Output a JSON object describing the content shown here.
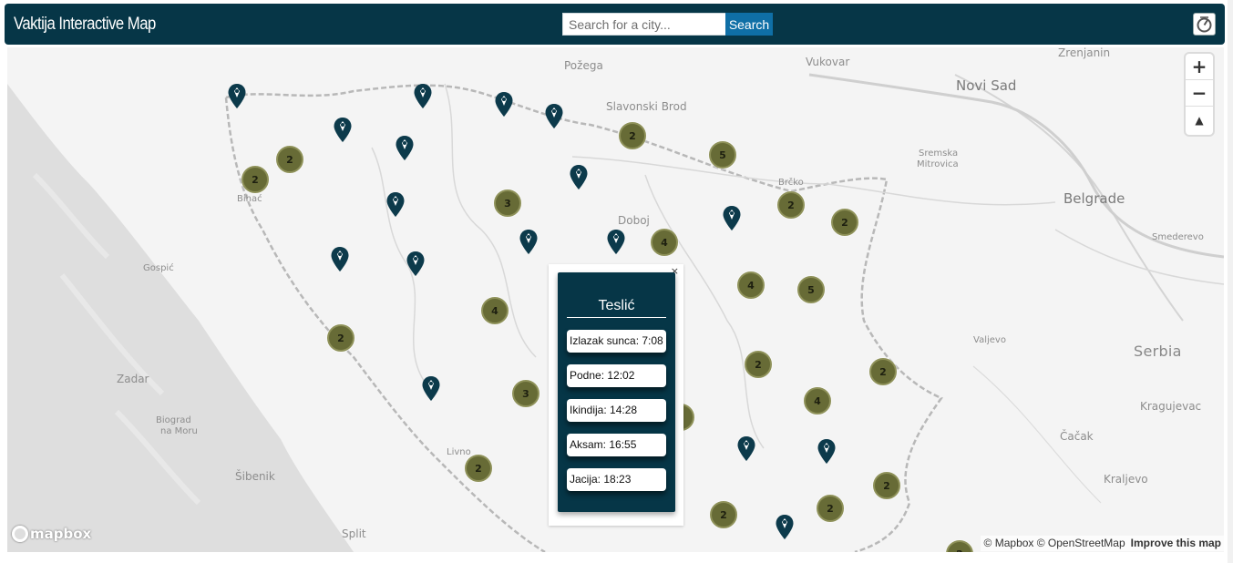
{
  "app": {
    "title": "Vaktija Interactive Map",
    "search_placeholder": "Search for a city...",
    "search_button": "Search",
    "locate_icon": "geolocate-icon"
  },
  "map_controls": {
    "zoom_in": "+",
    "zoom_out": "−",
    "compass": "▲"
  },
  "places": [
    {
      "name": "Požega",
      "kind": "city"
    },
    {
      "name": "Vukovar",
      "kind": "city"
    },
    {
      "name": "Zrenjanin",
      "kind": "city"
    },
    {
      "name": "Novi Sad",
      "kind": "large"
    },
    {
      "name": "Slavonski Brod",
      "kind": "city"
    },
    {
      "name": "Sremska",
      "kind": "small"
    },
    {
      "name": "Mitrovica",
      "kind": "small"
    },
    {
      "name": "Brčko",
      "kind": "small"
    },
    {
      "name": "Belgrade",
      "kind": "large"
    },
    {
      "name": "Doboj",
      "kind": "city"
    },
    {
      "name": "Bihać",
      "kind": "small"
    },
    {
      "name": "Smederevo",
      "kind": "small"
    },
    {
      "name": "Gospić",
      "kind": "small"
    },
    {
      "name": "Valjevo",
      "kind": "small"
    },
    {
      "name": "Serbia",
      "kind": "country"
    },
    {
      "name": "Zadar",
      "kind": "city"
    },
    {
      "name": "Kragujevac",
      "kind": "city"
    },
    {
      "name": "Biograd",
      "kind": "small"
    },
    {
      "name": "na Moru",
      "kind": "small"
    },
    {
      "name": "Čačak",
      "kind": "city"
    },
    {
      "name": "Livno",
      "kind": "small"
    },
    {
      "name": "Šibenik",
      "kind": "city"
    },
    {
      "name": "Kraljevo",
      "kind": "city"
    },
    {
      "name": "Split",
      "kind": "city"
    }
  ],
  "clusters": [
    {
      "count": "2"
    },
    {
      "count": "2"
    },
    {
      "count": "2"
    },
    {
      "count": "5"
    },
    {
      "count": "3"
    },
    {
      "count": "2"
    },
    {
      "count": "2"
    },
    {
      "count": "4"
    },
    {
      "count": "4"
    },
    {
      "count": "5"
    },
    {
      "count": "4"
    },
    {
      "count": "2"
    },
    {
      "count": "2"
    },
    {
      "count": "2"
    },
    {
      "count": "3"
    },
    {
      "count": "4"
    },
    {
      "count": "2"
    },
    {
      "count": "2"
    },
    {
      "count": "2"
    },
    {
      "count": "2"
    },
    {
      "count": "2"
    },
    {
      "count": "2"
    }
  ],
  "pins_count": 20,
  "popup": {
    "close": "×",
    "city": "Teslić",
    "prayers": [
      {
        "label": "Izlazak sunca: 7:08"
      },
      {
        "label": "Podne: 12:02"
      },
      {
        "label": "Ikindija: 14:28"
      },
      {
        "label": "Aksam: 16:55"
      },
      {
        "label": "Jacija: 18:23"
      }
    ]
  },
  "footer": {
    "logo": "mapbox",
    "attribution": "© Mapbox © OpenStreetMap",
    "improve": "Improve this map"
  },
  "colors": {
    "navbar": "#063647",
    "search_button": "#0f6fa6",
    "cluster": "#676b36",
    "pin": "#0c3a4b",
    "sea": "#dcdcdc",
    "land": "#f4f4f4"
  }
}
